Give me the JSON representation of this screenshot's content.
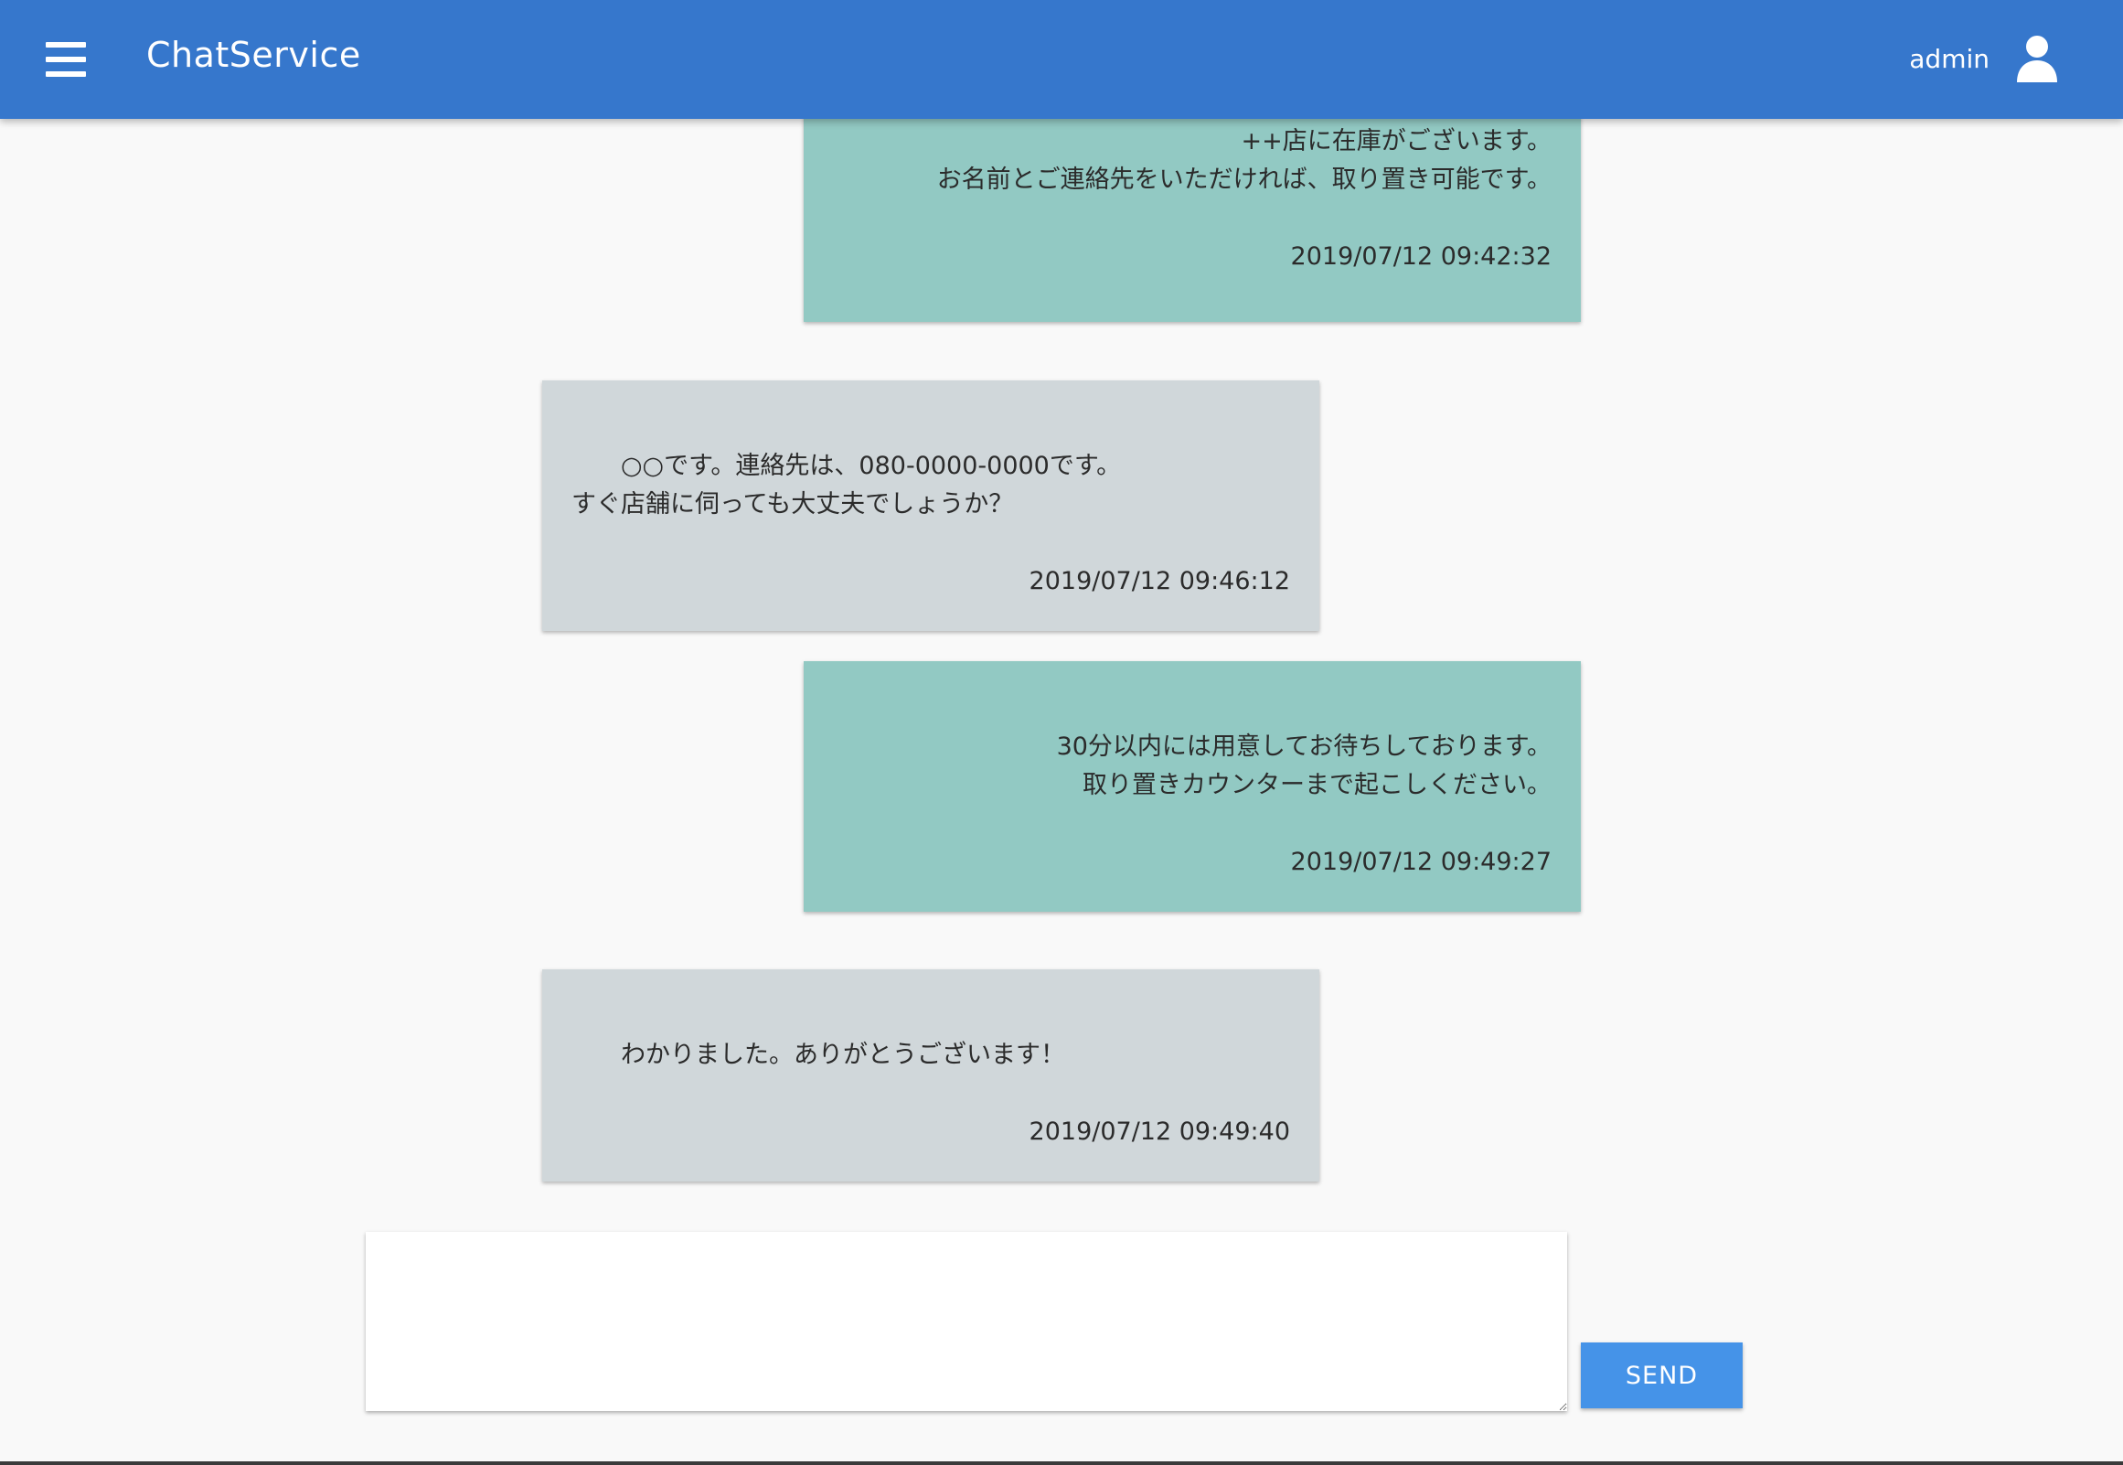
{
  "header": {
    "menu_icon": "hamburger-menu-icon",
    "title": "ChatService",
    "username": "admin",
    "user_icon": "user-icon"
  },
  "messages": [
    {
      "side": "sent",
      "text": "お問い合わせありがとうございます。\n++店に在庫がございます。\nお名前とご連絡先をいただければ、取り置き可能です。",
      "timestamp": "2019/07/12 09:42:32"
    },
    {
      "side": "received",
      "text": "　　○○です。連絡先は、080-0000-0000です。\nすぐ店舗に伺っても大丈夫でしょうか？",
      "timestamp": "2019/07/12 09:46:12"
    },
    {
      "side": "sent",
      "text": "30分以内には用意してお待ちしております。\n取り置きカウンターまで起こしください。",
      "timestamp": "2019/07/12 09:49:27"
    },
    {
      "side": "received",
      "text": "　　わかりました。ありがとうございます！",
      "timestamp": "2019/07/12 09:49:40"
    }
  ],
  "composer": {
    "value": "",
    "send_label": "SEND"
  },
  "colors": {
    "header": "#3677cc",
    "sent_bubble": "#92c9c3",
    "received_bubble": "#d0d7da",
    "send_button": "#4593e8",
    "background": "#f9f9f9"
  }
}
